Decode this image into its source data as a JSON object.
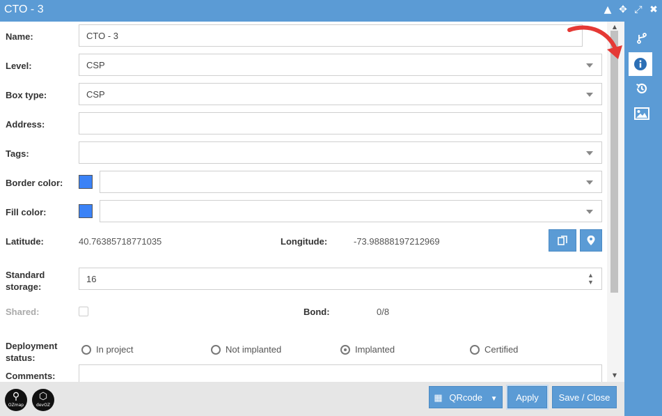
{
  "window": {
    "title": "CTO - 3"
  },
  "fields": {
    "name": {
      "label": "Name:",
      "value": "CTO - 3"
    },
    "level": {
      "label": "Level:",
      "value": "CSP"
    },
    "box_type": {
      "label": "Box type:",
      "value": "CSP"
    },
    "address": {
      "label": "Address:",
      "value": ""
    },
    "tags": {
      "label": "Tags:",
      "value": ""
    },
    "border_color": {
      "label": "Border color:",
      "value": "",
      "color": "#3b82f6"
    },
    "fill_color": {
      "label": "Fill color:",
      "value": "",
      "color": "#3b82f6"
    },
    "latitude": {
      "label": "Latitude:",
      "value": "40.76385718771035"
    },
    "longitude": {
      "label": "Longitude:",
      "value": "-73.98888197212969"
    },
    "standard_storage": {
      "label_line1": "Standard",
      "label_line2": "storage:",
      "value": "16"
    },
    "shared": {
      "label": "Shared:",
      "checked": false
    },
    "bond": {
      "label": "Bond:",
      "value": "0/8"
    },
    "deployment_status": {
      "label_line1": "Deployment",
      "label_line2": "status:",
      "options": [
        "In project",
        "Not implanted",
        "Implanted",
        "Certified"
      ],
      "selected": "Implanted"
    },
    "comments": {
      "label": "Comments:",
      "value": ""
    }
  },
  "footer": {
    "qrcode_label": "QRcode",
    "apply_label": "Apply",
    "save_close_label": "Save / Close",
    "logos": [
      "OZmap",
      "devOZ"
    ]
  },
  "sidebar": {
    "items": [
      "branch-icon",
      "info-icon",
      "history-icon",
      "image-icon"
    ],
    "active": "info-icon"
  },
  "colors": {
    "accent": "#5b9bd5",
    "annotation_arrow": "#e53935"
  }
}
